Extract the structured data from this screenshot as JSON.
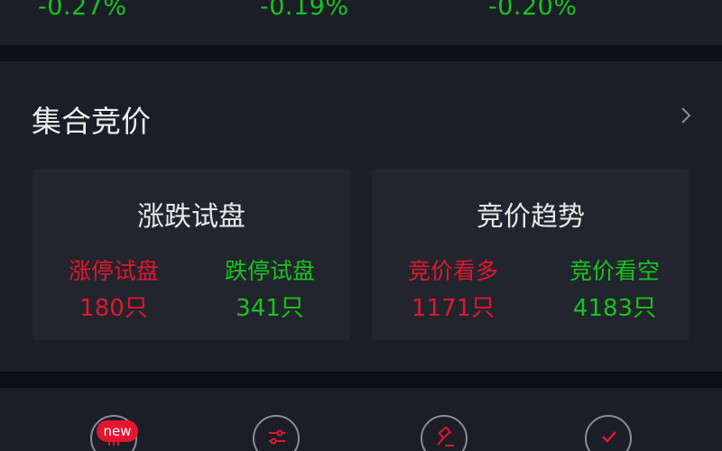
{
  "index_strip": {
    "changes": [
      "-0.27%",
      "-0.19%",
      "-0.20%"
    ]
  },
  "auction": {
    "title": "集合竞价",
    "cards": [
      {
        "title": "涨跌试盘",
        "stats": [
          {
            "label": "涨停试盘",
            "value": "180只",
            "color": "#e3162f"
          },
          {
            "label": "跌停试盘",
            "value": "341只",
            "color": "#17c41f"
          }
        ]
      },
      {
        "title": "竞价趋势",
        "stats": [
          {
            "label": "竞价看多",
            "value": "1171只",
            "color": "#e3162f"
          },
          {
            "label": "竞价看空",
            "value": "4183只",
            "color": "#17c41f"
          }
        ]
      }
    ]
  },
  "bottom_nav": {
    "badge": "new",
    "icons": [
      "list-icon",
      "sliders-icon",
      "gavel-icon",
      "check-icon"
    ]
  },
  "colors": {
    "up": "#e3162f",
    "down": "#17c41f",
    "background": "#0f1116",
    "panel": "#1b1e26",
    "card": "#22252d"
  }
}
